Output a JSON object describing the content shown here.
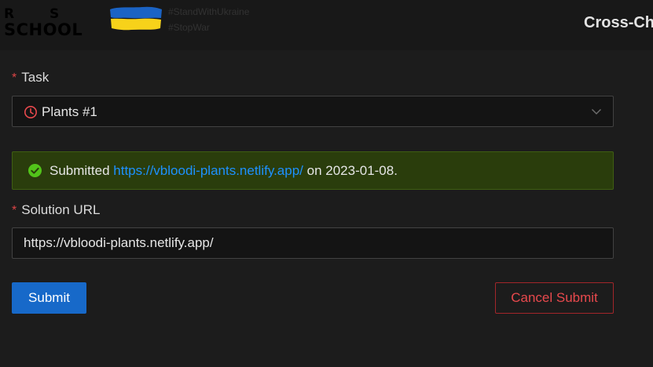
{
  "header": {
    "logo": {
      "r": "R",
      "s": "S",
      "school": "SCHOOL"
    },
    "tags": [
      "#StandWithUkraine",
      "#StopWar"
    ],
    "title": "Cross-Ch",
    "flag_colors": {
      "top": "#1b63c4",
      "bottom": "#f7d21a"
    }
  },
  "form": {
    "task": {
      "label": "Task",
      "required_mark": "*",
      "value": "Plants #1",
      "icon": "clock-icon",
      "dropdown_icon": "chevron-down-icon"
    },
    "alert": {
      "icon": "check-circle-icon",
      "prefix": "Submitted",
      "link": "https://vbloodi-plants.netlify.app/",
      "suffix": "on 2023-01-08."
    },
    "solution": {
      "label": "Solution URL",
      "required_mark": "*",
      "value": "https://vbloodi-plants.netlify.app/"
    },
    "buttons": {
      "submit": "Submit",
      "cancel": "Cancel Submit"
    }
  },
  "colors": {
    "background": "#1c1c1c",
    "primary": "#1769c9",
    "danger": "#e8494d",
    "success_bg": "#2a3d0c",
    "success_icon": "#52c41a",
    "link": "#1d91ff"
  }
}
